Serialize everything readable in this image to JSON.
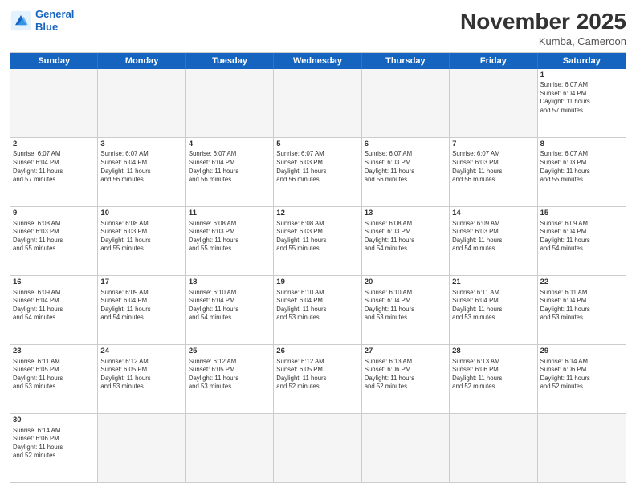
{
  "header": {
    "logo_line1": "General",
    "logo_line2": "Blue",
    "month_title": "November 2025",
    "location": "Kumba, Cameroon"
  },
  "day_headers": [
    "Sunday",
    "Monday",
    "Tuesday",
    "Wednesday",
    "Thursday",
    "Friday",
    "Saturday"
  ],
  "weeks": [
    {
      "days": [
        {
          "num": "",
          "info": "",
          "empty": true
        },
        {
          "num": "",
          "info": "",
          "empty": true
        },
        {
          "num": "",
          "info": "",
          "empty": true
        },
        {
          "num": "",
          "info": "",
          "empty": true
        },
        {
          "num": "",
          "info": "",
          "empty": true
        },
        {
          "num": "",
          "info": "",
          "empty": true
        },
        {
          "num": "1",
          "info": "Sunrise: 6:07 AM\nSunset: 6:04 PM\nDaylight: 11 hours\nand 57 minutes.",
          "empty": false
        }
      ]
    },
    {
      "days": [
        {
          "num": "2",
          "info": "Sunrise: 6:07 AM\nSunset: 6:04 PM\nDaylight: 11 hours\nand 57 minutes.",
          "empty": false
        },
        {
          "num": "3",
          "info": "Sunrise: 6:07 AM\nSunset: 6:04 PM\nDaylight: 11 hours\nand 56 minutes.",
          "empty": false
        },
        {
          "num": "4",
          "info": "Sunrise: 6:07 AM\nSunset: 6:04 PM\nDaylight: 11 hours\nand 56 minutes.",
          "empty": false
        },
        {
          "num": "5",
          "info": "Sunrise: 6:07 AM\nSunset: 6:03 PM\nDaylight: 11 hours\nand 56 minutes.",
          "empty": false
        },
        {
          "num": "6",
          "info": "Sunrise: 6:07 AM\nSunset: 6:03 PM\nDaylight: 11 hours\nand 56 minutes.",
          "empty": false
        },
        {
          "num": "7",
          "info": "Sunrise: 6:07 AM\nSunset: 6:03 PM\nDaylight: 11 hours\nand 56 minutes.",
          "empty": false
        },
        {
          "num": "8",
          "info": "Sunrise: 6:07 AM\nSunset: 6:03 PM\nDaylight: 11 hours\nand 55 minutes.",
          "empty": false
        }
      ]
    },
    {
      "days": [
        {
          "num": "9",
          "info": "Sunrise: 6:08 AM\nSunset: 6:03 PM\nDaylight: 11 hours\nand 55 minutes.",
          "empty": false
        },
        {
          "num": "10",
          "info": "Sunrise: 6:08 AM\nSunset: 6:03 PM\nDaylight: 11 hours\nand 55 minutes.",
          "empty": false
        },
        {
          "num": "11",
          "info": "Sunrise: 6:08 AM\nSunset: 6:03 PM\nDaylight: 11 hours\nand 55 minutes.",
          "empty": false
        },
        {
          "num": "12",
          "info": "Sunrise: 6:08 AM\nSunset: 6:03 PM\nDaylight: 11 hours\nand 55 minutes.",
          "empty": false
        },
        {
          "num": "13",
          "info": "Sunrise: 6:08 AM\nSunset: 6:03 PM\nDaylight: 11 hours\nand 54 minutes.",
          "empty": false
        },
        {
          "num": "14",
          "info": "Sunrise: 6:09 AM\nSunset: 6:03 PM\nDaylight: 11 hours\nand 54 minutes.",
          "empty": false
        },
        {
          "num": "15",
          "info": "Sunrise: 6:09 AM\nSunset: 6:04 PM\nDaylight: 11 hours\nand 54 minutes.",
          "empty": false
        }
      ]
    },
    {
      "days": [
        {
          "num": "16",
          "info": "Sunrise: 6:09 AM\nSunset: 6:04 PM\nDaylight: 11 hours\nand 54 minutes.",
          "empty": false
        },
        {
          "num": "17",
          "info": "Sunrise: 6:09 AM\nSunset: 6:04 PM\nDaylight: 11 hours\nand 54 minutes.",
          "empty": false
        },
        {
          "num": "18",
          "info": "Sunrise: 6:10 AM\nSunset: 6:04 PM\nDaylight: 11 hours\nand 54 minutes.",
          "empty": false
        },
        {
          "num": "19",
          "info": "Sunrise: 6:10 AM\nSunset: 6:04 PM\nDaylight: 11 hours\nand 53 minutes.",
          "empty": false
        },
        {
          "num": "20",
          "info": "Sunrise: 6:10 AM\nSunset: 6:04 PM\nDaylight: 11 hours\nand 53 minutes.",
          "empty": false
        },
        {
          "num": "21",
          "info": "Sunrise: 6:11 AM\nSunset: 6:04 PM\nDaylight: 11 hours\nand 53 minutes.",
          "empty": false
        },
        {
          "num": "22",
          "info": "Sunrise: 6:11 AM\nSunset: 6:04 PM\nDaylight: 11 hours\nand 53 minutes.",
          "empty": false
        }
      ]
    },
    {
      "days": [
        {
          "num": "23",
          "info": "Sunrise: 6:11 AM\nSunset: 6:05 PM\nDaylight: 11 hours\nand 53 minutes.",
          "empty": false
        },
        {
          "num": "24",
          "info": "Sunrise: 6:12 AM\nSunset: 6:05 PM\nDaylight: 11 hours\nand 53 minutes.",
          "empty": false
        },
        {
          "num": "25",
          "info": "Sunrise: 6:12 AM\nSunset: 6:05 PM\nDaylight: 11 hours\nand 53 minutes.",
          "empty": false
        },
        {
          "num": "26",
          "info": "Sunrise: 6:12 AM\nSunset: 6:05 PM\nDaylight: 11 hours\nand 52 minutes.",
          "empty": false
        },
        {
          "num": "27",
          "info": "Sunrise: 6:13 AM\nSunset: 6:06 PM\nDaylight: 11 hours\nand 52 minutes.",
          "empty": false
        },
        {
          "num": "28",
          "info": "Sunrise: 6:13 AM\nSunset: 6:06 PM\nDaylight: 11 hours\nand 52 minutes.",
          "empty": false
        },
        {
          "num": "29",
          "info": "Sunrise: 6:14 AM\nSunset: 6:06 PM\nDaylight: 11 hours\nand 52 minutes.",
          "empty": false
        }
      ]
    },
    {
      "days": [
        {
          "num": "30",
          "info": "Sunrise: 6:14 AM\nSunset: 6:06 PM\nDaylight: 11 hours\nand 52 minutes.",
          "empty": false
        },
        {
          "num": "",
          "info": "",
          "empty": true
        },
        {
          "num": "",
          "info": "",
          "empty": true
        },
        {
          "num": "",
          "info": "",
          "empty": true
        },
        {
          "num": "",
          "info": "",
          "empty": true
        },
        {
          "num": "",
          "info": "",
          "empty": true
        },
        {
          "num": "",
          "info": "",
          "empty": true
        }
      ]
    }
  ]
}
